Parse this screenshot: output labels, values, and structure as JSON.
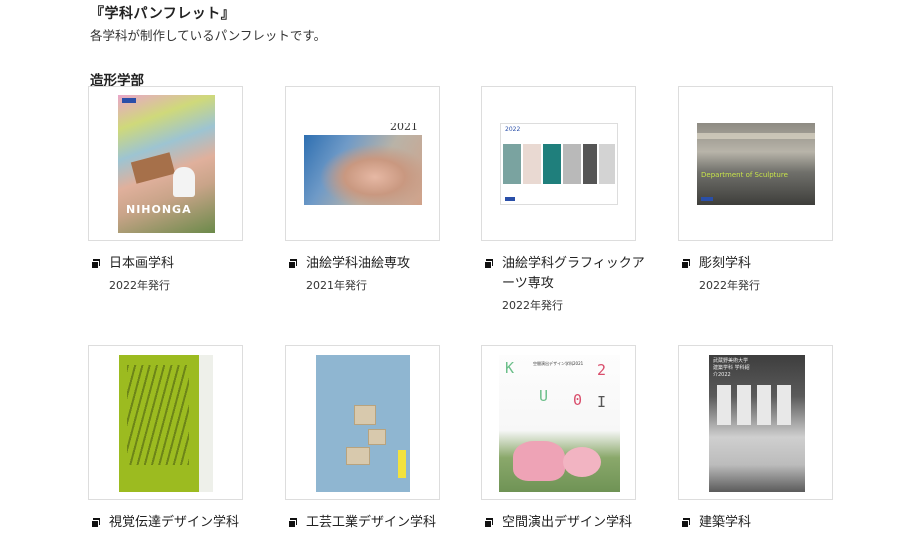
{
  "page": {
    "heading": "『学科パンフレット』",
    "description": "各学科が制作しているパンフレットです。",
    "section": "造形学部"
  },
  "cards": [
    {
      "title": "日本画学科",
      "year": "2022年発行",
      "cover_text": "NIHONGA"
    },
    {
      "title": "油絵学科油絵専攻",
      "year": "2021年発行",
      "cover_text": "2021"
    },
    {
      "title": "油絵学科グラフィックアーツ専攻",
      "year": "2022年発行",
      "cover_text": "2022"
    },
    {
      "title": "彫刻学科",
      "year": "2022年発行",
      "cover_text": "Department of Sculpture"
    },
    {
      "title": "視覚伝達デザイン学科",
      "year": ""
    },
    {
      "title": "工芸工業デザイン学科",
      "year": ""
    },
    {
      "title": "空間演出デザイン学科",
      "year": "",
      "cover_text": "空間演出デザイン学科2021"
    },
    {
      "title": "建築学科",
      "year": "",
      "cover_text": "武蔵野美術大学 建築学科 学科紹介2022"
    }
  ],
  "icons": {
    "bullet": "bullet-icon"
  },
  "colors": {
    "text": "#222222",
    "border": "#dddddd",
    "brand_blue": "#2a4fa8"
  }
}
